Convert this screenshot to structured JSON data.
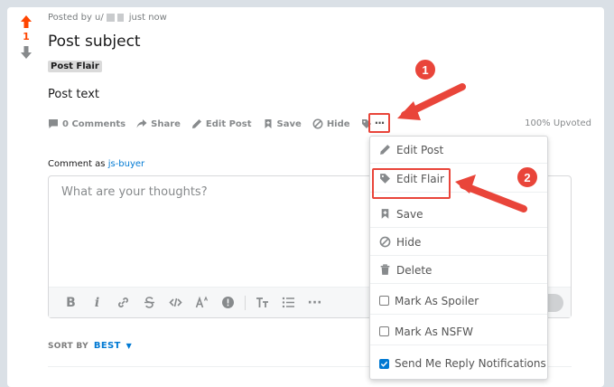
{
  "post": {
    "posted_by_prefix": "Posted by u/",
    "posted_time": "just now",
    "vote_count": "1",
    "title": "Post subject",
    "flair": "Post Flair",
    "body": "Post text",
    "upvoted": "100% Upvoted"
  },
  "actions": {
    "comments": "0 Comments",
    "share": "Share",
    "edit_post": "Edit Post",
    "save": "Save",
    "hide": "Hide",
    "more": "···"
  },
  "comment": {
    "label": "Comment as",
    "username": "js-buyer",
    "placeholder": "What are your thoughts?"
  },
  "toolbar": {
    "bold": "B",
    "italic": "i",
    "tt": "T",
    "more": "···"
  },
  "sort": {
    "label": "SORT BY",
    "value": "BEST"
  },
  "menu": {
    "items": [
      {
        "label": "Edit Post",
        "icon": "pencil-icon"
      },
      {
        "label": "Edit Flair",
        "icon": "tag-icon"
      },
      {
        "label": "Save",
        "icon": "bookmark-icon"
      },
      {
        "label": "Hide",
        "icon": "hide-icon"
      },
      {
        "label": "Delete",
        "icon": "trash-icon"
      },
      {
        "label": "Mark As Spoiler",
        "checked": false
      },
      {
        "label": "Mark As NSFW",
        "checked": false
      },
      {
        "label": "Send Me Reply Notifications",
        "checked": true
      }
    ]
  },
  "annotations": {
    "step1": "1",
    "step2": "2"
  },
  "colors": {
    "upvote": "#ff4500",
    "link": "#0079d3",
    "annotation_red": "#e9453a"
  }
}
